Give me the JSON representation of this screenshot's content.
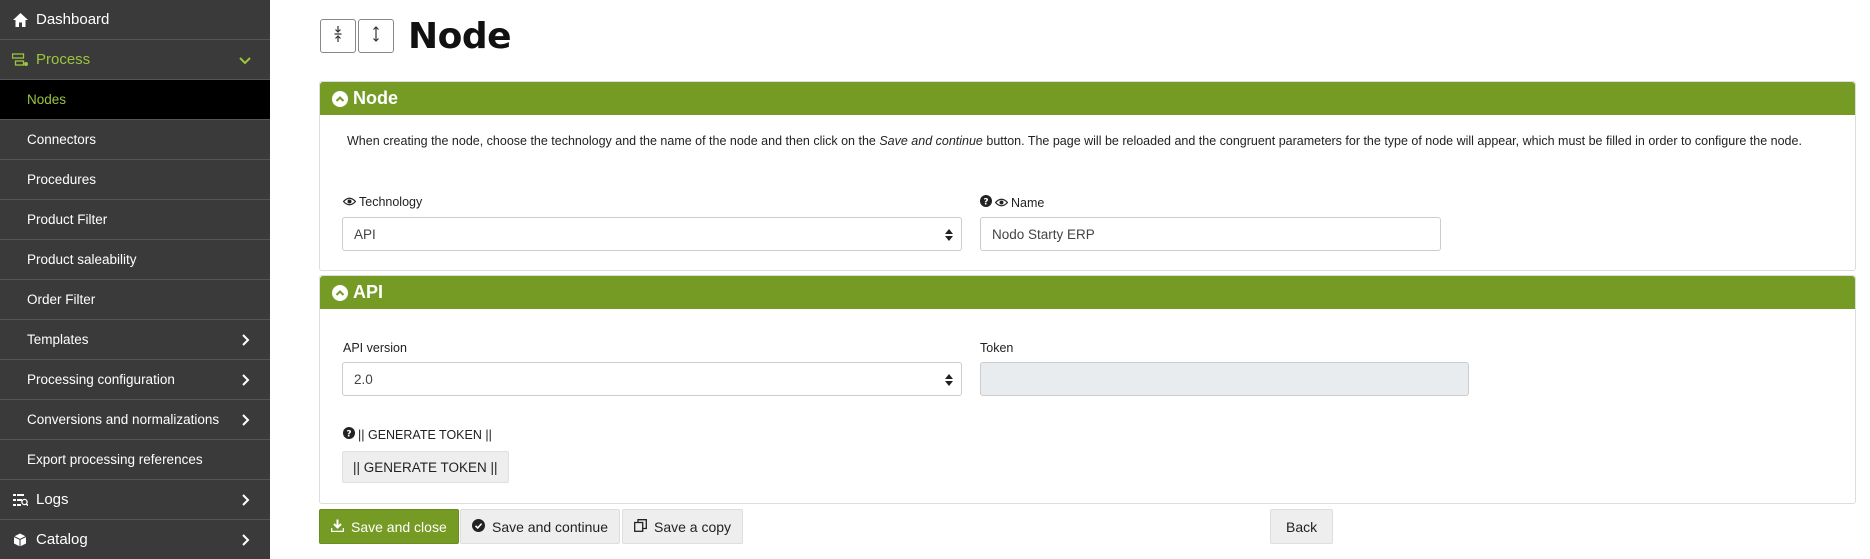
{
  "sidebar": {
    "items": [
      {
        "label": "Dashboard"
      },
      {
        "label": "Process"
      },
      {
        "label": "Nodes"
      },
      {
        "label": "Connectors"
      },
      {
        "label": "Procedures"
      },
      {
        "label": "Product Filter"
      },
      {
        "label": "Product saleability"
      },
      {
        "label": "Order Filter"
      },
      {
        "label": "Templates"
      },
      {
        "label": "Processing configuration"
      },
      {
        "label": "Conversions and normalizations"
      },
      {
        "label": "Export processing references"
      },
      {
        "label": "Logs"
      },
      {
        "label": "Catalog"
      }
    ]
  },
  "header": {
    "title": "Node",
    "collapse_all_icon": "collapse-vertical-icon",
    "expand_all_icon": "expand-vertical-icon"
  },
  "node_panel": {
    "title": "Node",
    "desc_before": "When creating the node, choose the technology and the name of the node and then click on the ",
    "desc_emph": "Save and continue",
    "desc_after": " button. The page will be reloaded and the congruent parameters for the type of node will appear, which must be filled in order to configure the node.",
    "technology_label": "Technology",
    "technology_value": "API",
    "name_label": "Name",
    "name_value": "Nodo Starty ERP"
  },
  "api_panel": {
    "title": "API",
    "version_label": "API version",
    "version_value": "2.0",
    "token_label": "Token",
    "token_value": "",
    "generate_label": "|| GENERATE TOKEN ||",
    "generate_button": "|| GENERATE TOKEN ||"
  },
  "actions": {
    "save_close": "Save and close",
    "save_continue": "Save and continue",
    "save_copy": "Save a copy",
    "back": "Back"
  },
  "colors": {
    "sidebar_bg": "#3a3a3a",
    "active_bg": "#000000",
    "accent": "#759b24",
    "accent_text": "#9bc53d"
  }
}
